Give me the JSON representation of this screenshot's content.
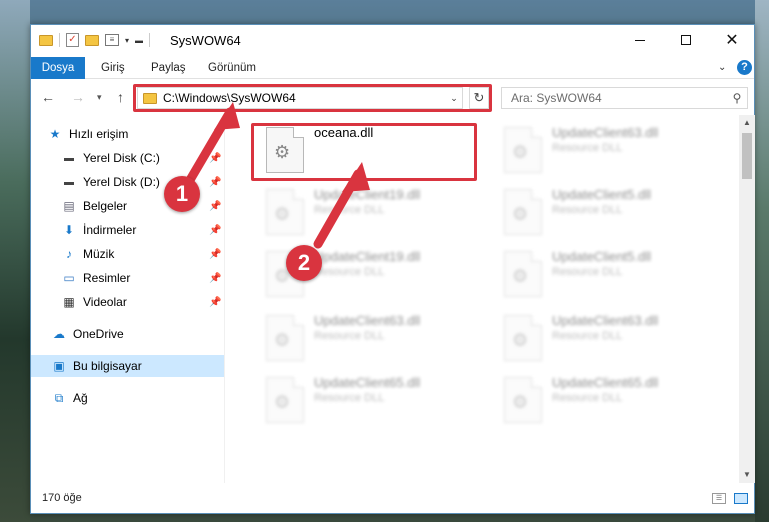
{
  "window": {
    "title": "SysWOW64"
  },
  "ribbon": {
    "tabs": [
      "Dosya",
      "Giriş",
      "Paylaş",
      "Görünüm"
    ],
    "help": "?"
  },
  "navigation": {
    "address": "C:\\Windows\\SysWOW64",
    "search_placeholder": "Ara: SysWOW64"
  },
  "sidebar": {
    "items": [
      {
        "label": "Hızlı erişim",
        "icon": "star-icon",
        "pinned": false
      },
      {
        "label": "Yerel Disk (C:)",
        "icon": "drive-icon",
        "pinned": true
      },
      {
        "label": "Yerel Disk (D:)",
        "icon": "drive-icon",
        "pinned": true
      },
      {
        "label": "Belgeler",
        "icon": "documents-icon",
        "pinned": true
      },
      {
        "label": "İndirmeler",
        "icon": "downloads-icon",
        "pinned": true
      },
      {
        "label": "Müzik",
        "icon": "music-icon",
        "pinned": true
      },
      {
        "label": "Resimler",
        "icon": "pictures-icon",
        "pinned": true
      },
      {
        "label": "Videolar",
        "icon": "videos-icon",
        "pinned": true
      },
      {
        "label": "OneDrive",
        "icon": "cloud-icon",
        "pinned": false
      },
      {
        "label": "Bu bilgisayar",
        "icon": "computer-icon",
        "pinned": false,
        "selected": true
      },
      {
        "label": "Ağ",
        "icon": "network-icon",
        "pinned": false
      }
    ]
  },
  "files": [
    {
      "name": "oceana.dll",
      "type": "",
      "highlighted": true
    },
    {
      "name": "UpdateClient63.dll",
      "type": "Resource DLL"
    },
    {
      "name": "UpdateClient19.dll",
      "type": "Resource DLL"
    },
    {
      "name": "UpdateClient5.dll",
      "type": "Resource DLL"
    },
    {
      "name": "UpdateClient19.dll",
      "type": "Resource DLL"
    },
    {
      "name": "UpdateClient5.dll",
      "type": "Resource DLL"
    },
    {
      "name": "UpdateClient63.dll",
      "type": "Resource DLL"
    },
    {
      "name": "UpdateClient63.dll",
      "type": "Resource DLL"
    },
    {
      "name": "UpdateClient65.dll",
      "type": "Resource DLL"
    },
    {
      "name": "UpdateClient65.dll",
      "type": "Resource DLL"
    }
  ],
  "status": {
    "item_count": "170 öğe"
  },
  "annotations": {
    "step1": "1",
    "step2": "2",
    "color": "#d9343f"
  }
}
